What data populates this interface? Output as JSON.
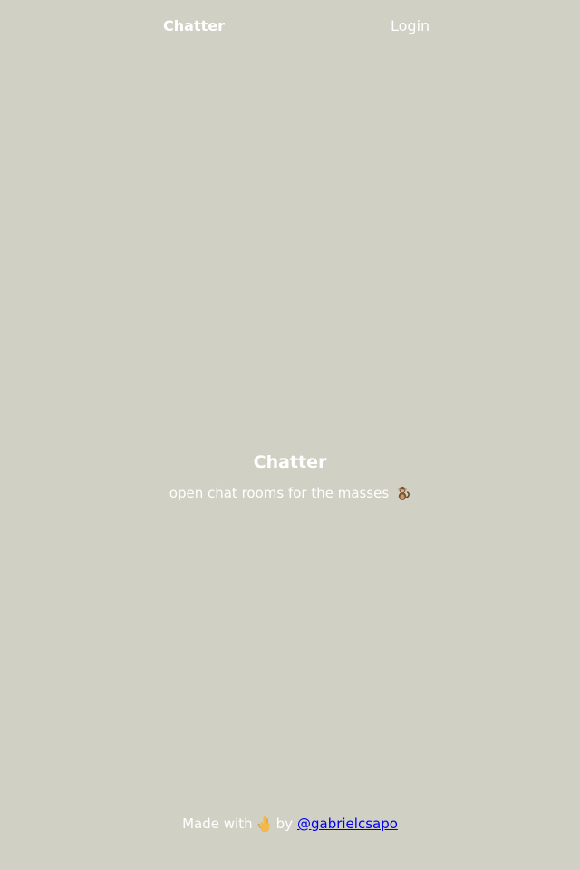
{
  "nav": {
    "brand": "Chatter",
    "login": "Login"
  },
  "hero": {
    "title": "Chatter",
    "tagline": "open chat rooms for the masses",
    "tagline_icon": "monkey-icon"
  },
  "footer": {
    "made_with": "Made with",
    "made_with_icon": "hand-icon",
    "by": "by",
    "author": "@gabrielcsapo"
  },
  "colors": {
    "background": "#d0d0c4",
    "text": "#ffffff",
    "link": "#0000ee"
  }
}
